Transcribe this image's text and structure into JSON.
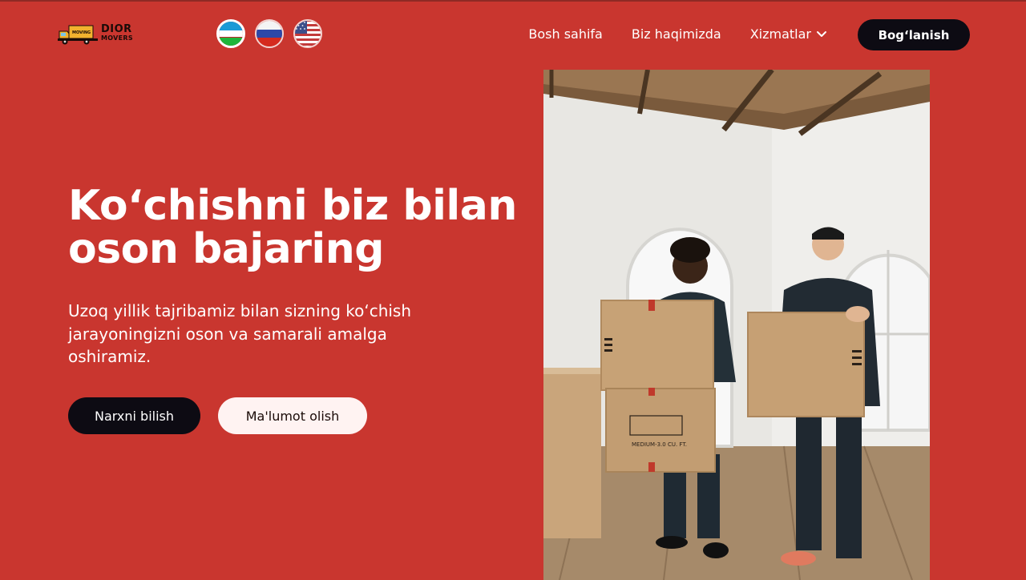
{
  "brand": {
    "logo_line1": "DIOR",
    "logo_line2": "MOVERS",
    "truck_text": "MOVING",
    "colors": {
      "background": "#c9362f",
      "dark": "#0d0b13",
      "light_button": "#fff3f2"
    }
  },
  "languages": [
    {
      "name": "uzbek-flag-icon",
      "active": true
    },
    {
      "name": "russian-flag-icon",
      "active": false
    },
    {
      "name": "us-flag-icon",
      "active": false
    }
  ],
  "nav": {
    "home": "Bosh sahifa",
    "about": "Biz haqimizda",
    "services": "Xizmatlar",
    "contact": "Bog‘lanish"
  },
  "hero": {
    "title": "Ko‘chishni biz bilan oson bajaring",
    "subtitle": "Uzoq yillik tajribamiz bilan sizning ko‘chish jarayoningizni oson va samarali amalga oshiramiz.",
    "primary_button": "Narxni bilish",
    "secondary_button": "Ma'lumot olish",
    "box_label": "MEDIUM-3.0 CU. FT."
  }
}
